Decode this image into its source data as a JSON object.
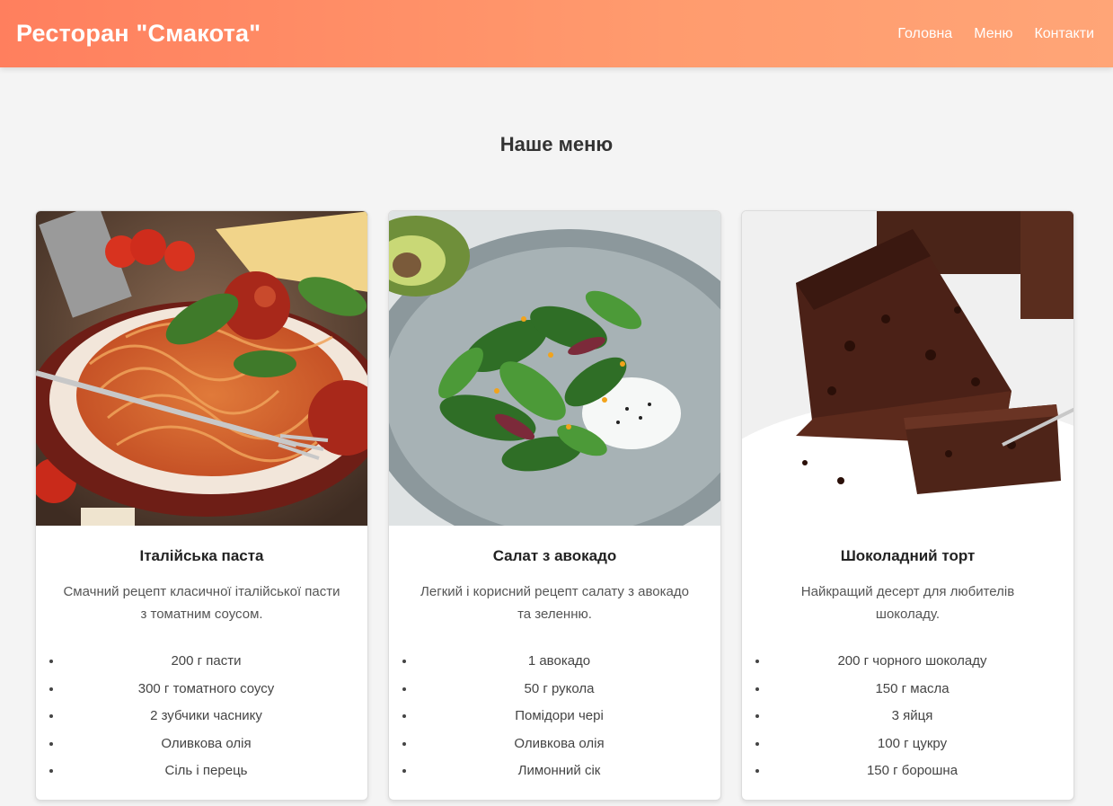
{
  "header": {
    "brand": "Ресторан \"Смакота\"",
    "nav": [
      "Головна",
      "Меню",
      "Контакти"
    ]
  },
  "section_title": "Наше меню",
  "dishes": [
    {
      "title": "Італійська паста",
      "description": "Смачний рецепт класичної італійської пасти з томатним соусом.",
      "ingredients": [
        "200 г пасти",
        "300 г томатного соусу",
        "2 зубчики часнику",
        "Оливкова олія",
        "Сіль і перець"
      ]
    },
    {
      "title": "Салат з авокадо",
      "description": "Легкий і корисний рецепт салату з авокадо та зеленню.",
      "ingredients": [
        "1 авокадо",
        "50 г рукола",
        "Помідори чері",
        "Оливкова олія",
        "Лимонний сік"
      ]
    },
    {
      "title": "Шоколадний торт",
      "description": "Найкращий десерт для любителів шоколаду.",
      "ingredients": [
        "200 г чорного шоколаду",
        "150 г масла",
        "3 яйця",
        "100 г цукру",
        "150 г борошна"
      ]
    }
  ],
  "colors": {
    "header_start": "#ff7f5e",
    "header_end": "#ffa577",
    "background": "#f4f4f4"
  }
}
